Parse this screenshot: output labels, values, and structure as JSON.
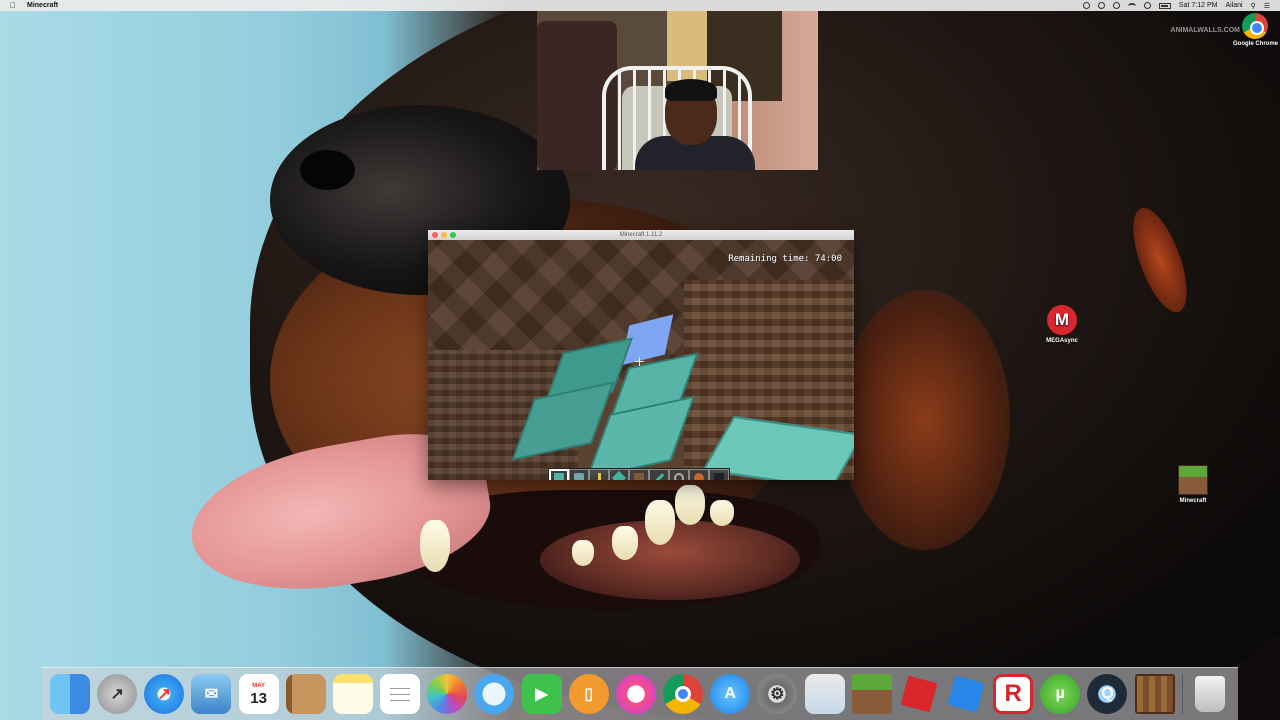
{
  "menubar": {
    "app_name": "Minecraft",
    "time": "Sat 7:12 PM",
    "user": "Ailani"
  },
  "wallpaper": {
    "watermark": "ANIMALWALLS.COM"
  },
  "minecraft_window": {
    "title": "Minecraft 1.11.2",
    "hud_remaining": "Remaining time: 74:00",
    "hotbar_selected_slot": 1
  },
  "desktop_icons": {
    "chrome": "Google Chrome",
    "mega": "MEGAsync",
    "minecraft": "Minecraft"
  },
  "dock": {
    "calendar_month": "MAY",
    "calendar_day": "13",
    "items": [
      "Finder",
      "Launchpad",
      "Safari",
      "Mail",
      "Calendar",
      "Contacts",
      "Notes",
      "Reminders",
      "Photos",
      "Messages",
      "FaceTime",
      "iBooks",
      "iTunes",
      "Google Chrome",
      "App Store",
      "System Preferences",
      "Preview",
      "Minecraft",
      "Roblox",
      "Roblox",
      "Roblox Studio",
      "uTorrent",
      "QuickTime Player",
      "Minecraft Launcher",
      "Trash"
    ]
  }
}
